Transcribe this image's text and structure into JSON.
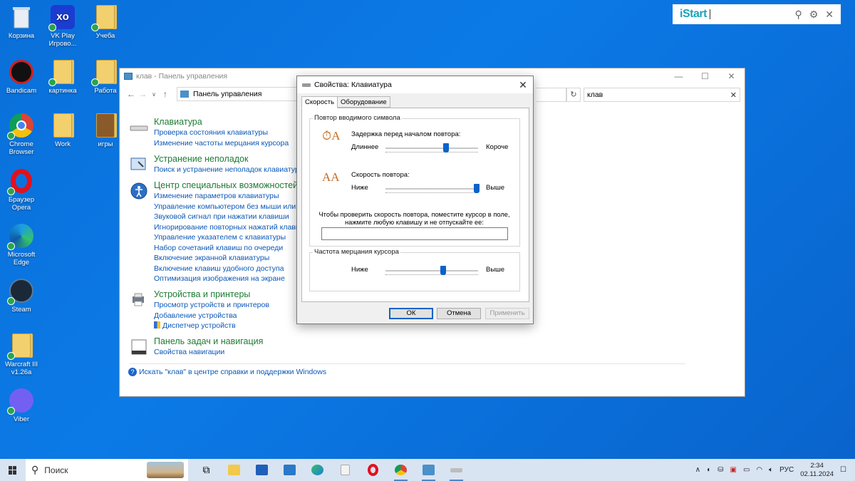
{
  "desktop": {
    "icons": [
      {
        "label": "Корзина",
        "icon": "recycle-bin-icon"
      },
      {
        "label": "VK Play Игрово...",
        "icon": "vk-play-icon"
      },
      {
        "label": "Учеба",
        "icon": "folder-icon"
      },
      {
        "label": "Bandicam",
        "icon": "bandicam-icon"
      },
      {
        "label": "картинка",
        "icon": "folder-icon"
      },
      {
        "label": "Работа",
        "icon": "folder-icon"
      },
      {
        "label": "Chrome Browser",
        "icon": "chrome-icon"
      },
      {
        "label": "Work",
        "icon": "folder-icon"
      },
      {
        "label": "игры",
        "icon": "folder-icon"
      },
      {
        "label": "Браузер Opera",
        "icon": "opera-icon"
      },
      {
        "label": "Microsoft Edge",
        "icon": "edge-icon"
      },
      {
        "label": "Steam",
        "icon": "steam-icon"
      },
      {
        "label": "Warcraft III v1.26a",
        "icon": "folder-icon"
      },
      {
        "label": "Viber",
        "icon": "viber-icon"
      }
    ]
  },
  "istart": {
    "logo": "iStart"
  },
  "control_panel": {
    "title": "клав - Панель управления",
    "address": "Панель управления",
    "search_value": "клав",
    "categories": [
      {
        "title": "Клавиатура",
        "links": [
          "Проверка состояния клавиатуры",
          "Изменение частоты мерцания курсора"
        ]
      },
      {
        "title": "Устранение неполадок",
        "links": [
          "Поиск и устранение неполадок клавиатуры"
        ]
      },
      {
        "title": "Центр специальных возможностей",
        "links": [
          "Изменение параметров клавиатуры",
          "Управление компьютером без мыши или клав",
          "Звуковой сигнал при нажатии клавиши",
          "Игнорирование повторных нажатий клавиш с",
          "Управление указателем с клавиатуры",
          "Набор сочетаний клавиш по очереди",
          "Включение экранной клавиатуры",
          "Включение клавиш удобного доступа",
          "Оптимизация изображения на экране"
        ]
      },
      {
        "title": "Устройства и принтеры",
        "links": [
          "Просмотр устройств и принтеров",
          "Добавление устройства",
          "Диспетчер устройств"
        ]
      },
      {
        "title": "Панель задач и навигация",
        "links": [
          "Свойства навигации"
        ]
      }
    ],
    "help_link": "Искать \"клав\" в центре справки и поддержки Windows"
  },
  "dialog": {
    "title": "Свойства: Клавиатура",
    "tabs": [
      "Скорость",
      "Оборудование"
    ],
    "repeat_group": "Повтор вводимого символа",
    "delay_label": "Задержка перед началом повтора:",
    "delay_left": "Длиннее",
    "delay_right": "Короче",
    "delay_level": 0.65,
    "rate_label": "Скорость повтора:",
    "rate_left": "Ниже",
    "rate_right": "Выше",
    "rate_level": 1.0,
    "test_hint": "Чтобы проверить скорость повтора, поместите курсор в поле, нажмите любую клавишу и не отпускайте ее:",
    "blink_group": "Частота мерцания курсора",
    "blink_left": "Ниже",
    "blink_right": "Выше",
    "blink_level": 0.62,
    "buttons": {
      "ok": "ОК",
      "cancel": "Отмена",
      "apply": "Применить"
    }
  },
  "taskbar": {
    "search_placeholder": "Поиск",
    "language": "РУС",
    "time": "2:34",
    "date": "02.11.2024"
  },
  "colors": {
    "accent": "#0a63c9",
    "link": "#0a58b8",
    "category": "#1e7b34",
    "desktop": "#0b7ae6"
  }
}
